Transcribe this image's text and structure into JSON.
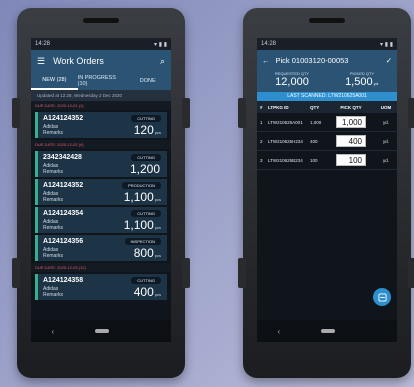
{
  "left": {
    "status_time": "14:28",
    "title": "Work Orders",
    "tabs": [
      {
        "label": "NEW (28)"
      },
      {
        "label": "IN PROGRESS (10)"
      },
      {
        "label": "DONE"
      }
    ],
    "updated": "Updated at 12:28, Wednesday 2 Dec 2020",
    "group1": "DUE DATE: 2020-12-01 (1)",
    "group2": "DUE DATE: 2020-12-02 (4)",
    "group3": "DUE DATE: 2020-12-03 (12)",
    "orders": [
      {
        "code": "A124124352",
        "brand": "Adidas",
        "remarks": "Remarks",
        "status": "CUTTING",
        "qty": "120",
        "unit": "pcs"
      },
      {
        "code": "2342342428",
        "brand": "Adidas",
        "remarks": "Remarks",
        "status": "CUTTING",
        "qty": "1,200",
        "unit": ""
      },
      {
        "code": "A124124352",
        "brand": "Adidas",
        "remarks": "Remarks",
        "status": "PRODUCTION",
        "qty": "1,100",
        "unit": "pcs"
      },
      {
        "code": "A124124354",
        "brand": "Adidas",
        "remarks": "Remarks",
        "status": "CUTTING",
        "qty": "1,100",
        "unit": "pcs"
      },
      {
        "code": "A124124356",
        "brand": "Adidas",
        "remarks": "Remarks",
        "status": "INSPECTION",
        "qty": "800",
        "unit": "pcs"
      },
      {
        "code": "A124124358",
        "brand": "Adidas",
        "remarks": "Remarks",
        "status": "CUTTING",
        "qty": "400",
        "unit": "pcs"
      }
    ]
  },
  "right": {
    "status_time": "14:28",
    "title": "Pick 01003120-00053",
    "requested_label": "REQUESTED QTY",
    "requested_value": "12,000",
    "picked_label": "PICKED QTY",
    "picked_value": "1,500",
    "picked_unit": "yd.",
    "last_scanned": "LAST SCANNED: LTW210625A001",
    "headers": {
      "idx": "#",
      "id": "LTPKG ID",
      "qty": "QTY",
      "pick": "PICK QTY",
      "uom": "UOM"
    },
    "rows": [
      {
        "idx": "1",
        "id": "LTW210625A001",
        "qty": "1,000",
        "pick": "1,000",
        "uom": "yd."
      },
      {
        "idx": "2",
        "id": "LTW210625H234",
        "qty": "400",
        "pick": "400",
        "uom": "yd."
      },
      {
        "idx": "3",
        "id": "LTW210625B234",
        "qty": "100",
        "pick": "100",
        "uom": "yd."
      }
    ]
  },
  "colors": {
    "appbar": "#2b5373",
    "accent": "#2e8fcf",
    "card_border": "#35b08b",
    "due_date": "#e45c69"
  }
}
